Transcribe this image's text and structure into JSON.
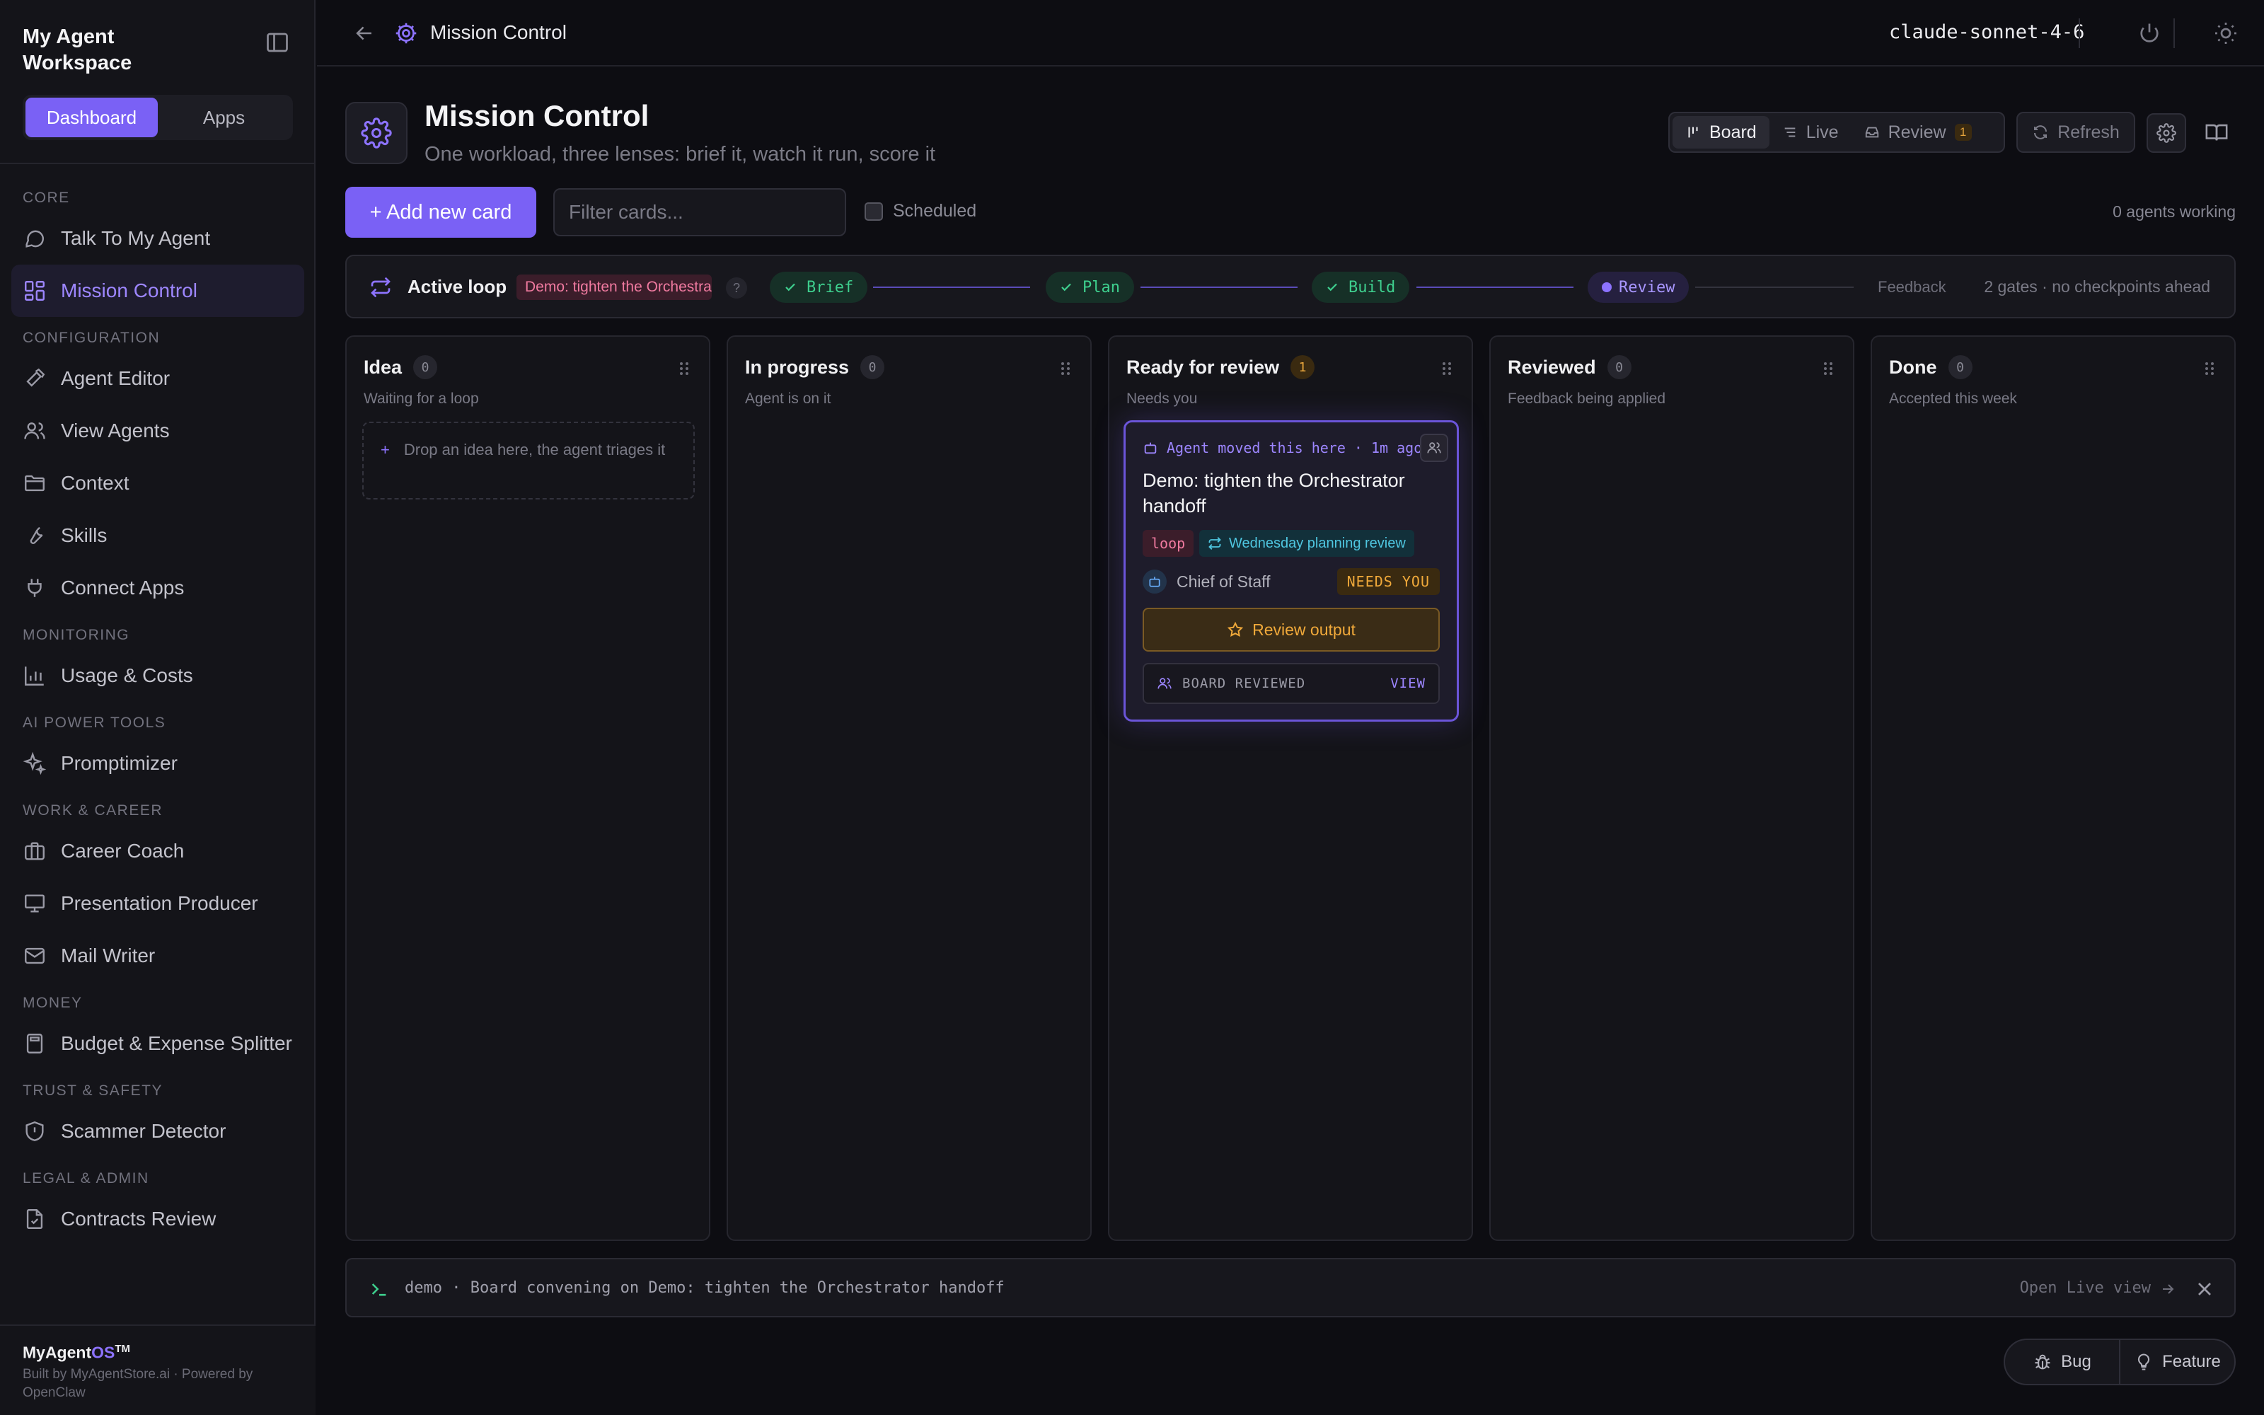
{
  "sidebar": {
    "workspace_title": "My Agent Workspace",
    "tabs": [
      {
        "label": "Dashboard",
        "active": true
      },
      {
        "label": "Apps",
        "active": false
      }
    ],
    "sections": [
      {
        "label": "CORE",
        "items": [
          {
            "label": "Talk To My Agent",
            "icon": "chat-bubble-icon"
          },
          {
            "label": "Mission Control",
            "icon": "dashboard-grid-icon",
            "active": true
          }
        ]
      },
      {
        "label": "CONFIGURATION",
        "items": [
          {
            "label": "Agent Editor",
            "icon": "hammer-icon"
          },
          {
            "label": "View Agents",
            "icon": "users-icon"
          },
          {
            "label": "Context",
            "icon": "folder-icon"
          },
          {
            "label": "Skills",
            "icon": "wrench-icon"
          },
          {
            "label": "Connect Apps",
            "icon": "plug-icon"
          }
        ]
      },
      {
        "label": "MONITORING",
        "items": [
          {
            "label": "Usage & Costs",
            "icon": "bar-chart-icon"
          }
        ]
      },
      {
        "label": "AI POWER TOOLS",
        "items": [
          {
            "label": "Promptimizer",
            "icon": "sparkles-icon"
          }
        ]
      },
      {
        "label": "WORK & CAREER",
        "items": [
          {
            "label": "Career Coach",
            "icon": "briefcase-icon"
          },
          {
            "label": "Presentation Producer",
            "icon": "presentation-icon"
          },
          {
            "label": "Mail Writer",
            "icon": "mail-icon"
          }
        ]
      },
      {
        "label": "MONEY",
        "items": [
          {
            "label": "Budget & Expense Splitter",
            "icon": "calculator-icon"
          }
        ]
      },
      {
        "label": "TRUST & SAFETY",
        "items": [
          {
            "label": "Scammer Detector",
            "icon": "shield-icon"
          }
        ]
      },
      {
        "label": "LEGAL & ADMIN",
        "items": [
          {
            "label": "Contracts Review",
            "icon": "file-check-icon"
          }
        ]
      }
    ],
    "footer": {
      "brand_main": "MyAgent",
      "brand_os": "OS",
      "brand_tm": "TM",
      "built_by": "Built by MyAgentStore.ai · Powered by OpenClaw"
    }
  },
  "topbar": {
    "title": "Mission Control",
    "model": "claude-sonnet-4-6"
  },
  "header": {
    "title": "Mission Control",
    "subtitle": "One workload, three lenses: brief it, watch it run, score it",
    "lenses": [
      {
        "label": "Board",
        "icon": "board-icon",
        "active": true
      },
      {
        "label": "Live",
        "icon": "list-icon",
        "active": false
      },
      {
        "label": "Review",
        "icon": "inbox-icon",
        "active": false,
        "badge": "1"
      }
    ],
    "refresh_label": "Refresh"
  },
  "toolbar": {
    "add_label": "+ Add new card",
    "filter_placeholder": "Filter cards...",
    "scheduled_label": "Scheduled",
    "agents_working": "0 agents working"
  },
  "loop": {
    "label": "Active loop",
    "chip": "Demo: tighten the Orchestrator handoff",
    "help": "?",
    "steps": [
      {
        "label": "Brief",
        "state": "done"
      },
      {
        "label": "Plan",
        "state": "done"
      },
      {
        "label": "Build",
        "state": "done"
      },
      {
        "label": "Review",
        "state": "current"
      },
      {
        "label": "Feedback",
        "state": "pending"
      }
    ],
    "meta": "2 gates · no checkpoints ahead",
    "colors": {
      "done": "#3ecf8e",
      "current": "#8d73ff",
      "line_done": "#5a4bb8",
      "line_pending": "#33333d"
    }
  },
  "board": {
    "columns": [
      {
        "title": "Idea",
        "count": "0",
        "subtitle": "Waiting for a loop",
        "drop_hint": "Drop an idea here, the agent triages it"
      },
      {
        "title": "In progress",
        "count": "0",
        "subtitle": "Agent is on it"
      },
      {
        "title": "Ready for review",
        "count": "1",
        "subtitle": "Needs you"
      },
      {
        "title": "Reviewed",
        "count": "0",
        "subtitle": "Feedback being applied"
      },
      {
        "title": "Done",
        "count": "0",
        "subtitle": "Accepted this week"
      }
    ],
    "card": {
      "moved": "Agent moved this here · 1m ago",
      "title": "Demo: tighten the Orchestrator handoff",
      "tag_loop": "loop",
      "tag_cadence": "Wednesday planning review",
      "owner": "Chief of Staff",
      "status": "NEEDS YOU",
      "review_label": "Review output",
      "board_reviewed": "BOARD REVIEWED",
      "view_label": "VIEW"
    }
  },
  "status_line": {
    "text": "demo · Board convening on Demo: tighten the Orchestrator handoff",
    "link": "Open Live view"
  },
  "feedback": {
    "bug_label": "Bug",
    "feature_label": "Feature"
  },
  "theme": {
    "accent": "#7a61f5",
    "background": "#0d0d12",
    "warning": "#e7a53c",
    "success": "#3ecf8e"
  }
}
